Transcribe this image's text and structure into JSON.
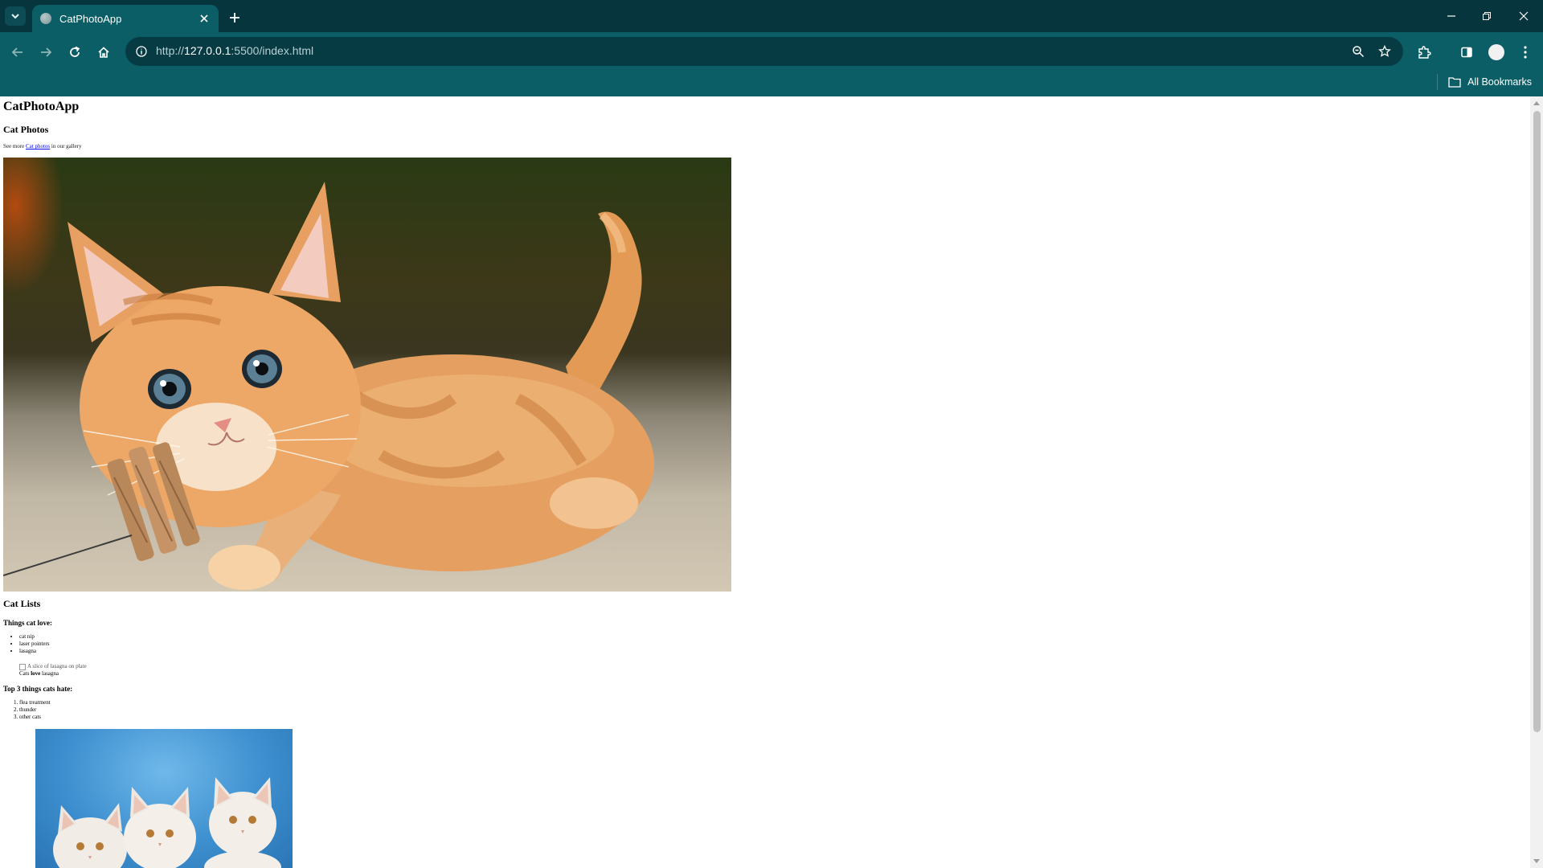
{
  "browser": {
    "tab_title": "CatPhotoApp",
    "url_prefix": "http://",
    "url_host": "127.0.0.1",
    "url_rest": ":5500/index.html",
    "bookmarks_label": "All Bookmarks",
    "theme_color": "#0b5e66"
  },
  "page": {
    "title": "CatPhotoApp",
    "section_photos": "Cat Photos",
    "gallery_text_before": "See more ",
    "gallery_link": "Cat photos",
    "gallery_text_after": " in our gallery",
    "section_lists": "Cat Lists",
    "love_heading": "Things cat love:",
    "love_items": [
      "cat nip",
      "laser pointers",
      "lasagna"
    ],
    "lasagna_img_alt": "A slice of lasagna on plate",
    "caption_before": "Cats ",
    "caption_emphasis": "love",
    "caption_after": " lasagna",
    "hate_heading": "Top 3 things cats hate:",
    "hate_items": [
      "flea treatment",
      "thunder",
      "other cats"
    ]
  },
  "icons": {
    "tab_search": "chevron-down-icon",
    "favicon": "globe-icon",
    "tab_close": "close-icon",
    "new_tab": "plus-icon",
    "back": "arrow-left-icon",
    "forward": "arrow-right-icon",
    "reload": "reload-icon",
    "home": "home-icon",
    "site_info": "info-icon",
    "zoom": "zoom-icon",
    "bookmark": "star-icon",
    "extensions": "puzzle-icon",
    "side_panel": "side-panel-icon",
    "profile": "avatar",
    "menu": "kebab-menu-icon",
    "folder": "folder-icon"
  }
}
